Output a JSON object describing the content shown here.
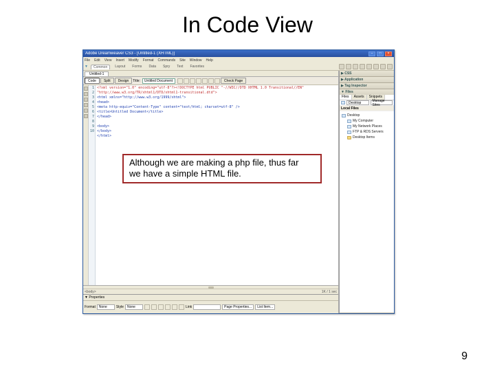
{
  "slide": {
    "title": "In Code View",
    "page_number": "9"
  },
  "callout": {
    "line1": "Although we are making a php file, thus far",
    "line2": "we have a simple HTML file."
  },
  "titlebar": {
    "text": "Adobe Dreamweaver CS3 - [Untitled-1 (XHTML)]"
  },
  "menu": {
    "items": [
      "File",
      "Edit",
      "View",
      "Insert",
      "Modify",
      "Format",
      "Commands",
      "Site",
      "Window",
      "Help"
    ]
  },
  "insertbar": {
    "tabs": [
      "Common",
      "Layout",
      "Forms",
      "Data",
      "Spry",
      "Text",
      "Favorites"
    ],
    "active": 0
  },
  "doc": {
    "tab": "Untitled-1",
    "views": [
      "Code",
      "Split",
      "Design"
    ],
    "active_view": 0,
    "title_label": "Title:",
    "title_value": "Untitled Document",
    "check_label": "Check Page"
  },
  "code": {
    "lines": [
      "1",
      "2",
      "3",
      "4",
      "5",
      "6",
      "7",
      "8",
      "9",
      "10"
    ],
    "l1": "<?xml version=\"1.0\" encoding=\"utf-8\"?><!DOCTYPE html PUBLIC \"-//W3C//DTD XHTML 1.0 Transitional//EN\"",
    "l2": "\"http://www.w3.org/TR/xhtml1/DTD/xhtml1-transitional.dtd\">",
    "l3": "<html xmlns=\"http://www.w3.org/1999/xhtml\">",
    "l4": "<head>",
    "l5": "<meta http-equiv=\"Content-Type\" content=\"text/html; charset=utf-8\" />",
    "l6": "<title>Untitled Document</title>",
    "l7": "</head>",
    "l8": "",
    "l9": "<body>",
    "l10a": "</body>",
    "l10b": "</html>"
  },
  "statusbar": {
    "left": "<body>",
    "right": "1K / 1 sec"
  },
  "properties": {
    "header": "▼ Properties",
    "format_label": "Format",
    "format_value": "None",
    "style_label": "Style",
    "style_value": "None",
    "css_label": "CSS",
    "link_label": "Link",
    "page_props": "Page Properties...",
    "list_item": "List Item..."
  },
  "panels": {
    "css": "▶ CSS",
    "app": "▶ Application",
    "tag": "▶ Tag Inspector",
    "files": "▼ Files",
    "files_tabs": [
      "Files",
      "Assets",
      "Snippets"
    ],
    "site_select": "Desktop",
    "view_select": "Manage Sites",
    "col_name": "Local Files",
    "tree": {
      "root": "Desktop",
      "items": [
        "My Computer",
        "My Network Places",
        "FTP & RDS Servers",
        "Desktop Items"
      ]
    }
  }
}
